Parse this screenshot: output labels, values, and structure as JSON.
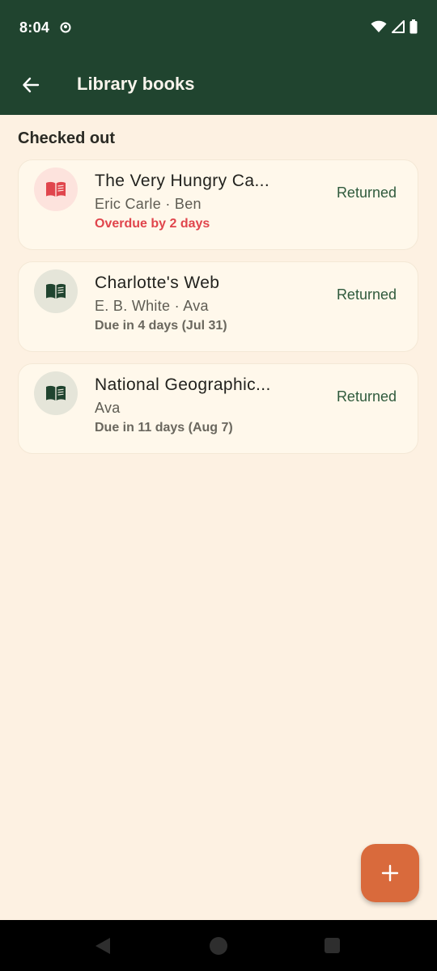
{
  "status_bar": {
    "time": "8:04",
    "icons": [
      "data-saver-icon",
      "wifi-icon",
      "signal-icon",
      "battery-icon"
    ]
  },
  "app_bar": {
    "title": "Library books",
    "back_icon": "arrow-back-icon",
    "color": "#20442F"
  },
  "section": {
    "title": "Checked out"
  },
  "books": [
    {
      "title": "The Very Hungry Ca...",
      "meta": "Eric Carle · Ben",
      "due": "Overdue by 2 days",
      "overdue": true,
      "action": "Returned",
      "icon": "book-open-icon"
    },
    {
      "title": "Charlotte's Web",
      "meta": "E. B. White · Ava",
      "due": "Due in 4 days (Jul 31)",
      "overdue": false,
      "action": "Returned",
      "icon": "book-open-icon"
    },
    {
      "title": "National Geographic...",
      "meta": "Ava",
      "due": "Due in 11 days (Aug 7)",
      "overdue": false,
      "action": "Returned",
      "icon": "book-open-icon"
    }
  ],
  "fab": {
    "icon": "plus-icon",
    "color": "#D96A3C"
  },
  "colors": {
    "background": "#FDF1E2",
    "overdue": "#E0454C",
    "accent": "#2F5A3C"
  },
  "nav_bar": {
    "icons": [
      "nav-back-icon",
      "nav-home-icon",
      "nav-recents-icon"
    ]
  }
}
